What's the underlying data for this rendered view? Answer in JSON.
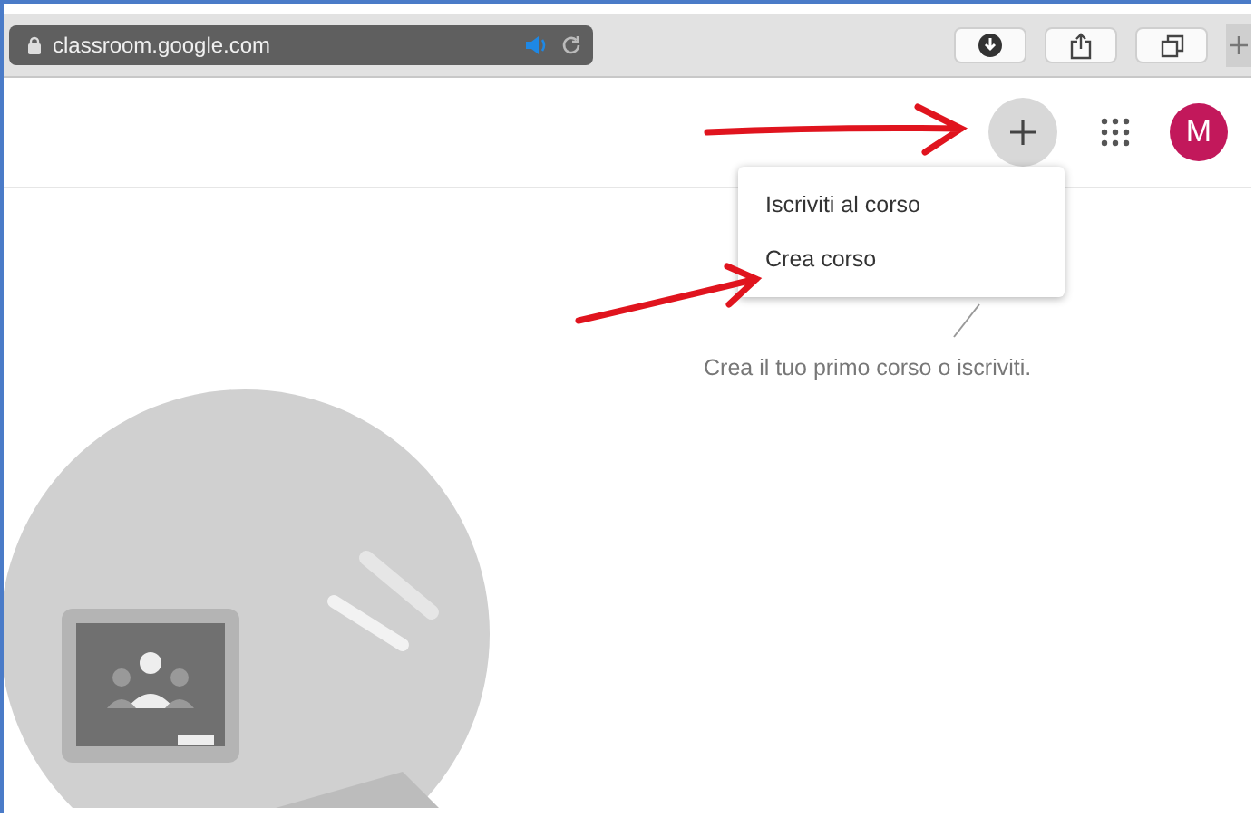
{
  "browser": {
    "address": "classroom.google.com"
  },
  "header": {
    "avatar_letter": "M"
  },
  "menu": {
    "items": [
      {
        "label": "Iscriviti al corso"
      },
      {
        "label": "Crea corso"
      }
    ]
  },
  "empty_state": {
    "message": "Crea il tuo primo corso o iscriviti."
  }
}
